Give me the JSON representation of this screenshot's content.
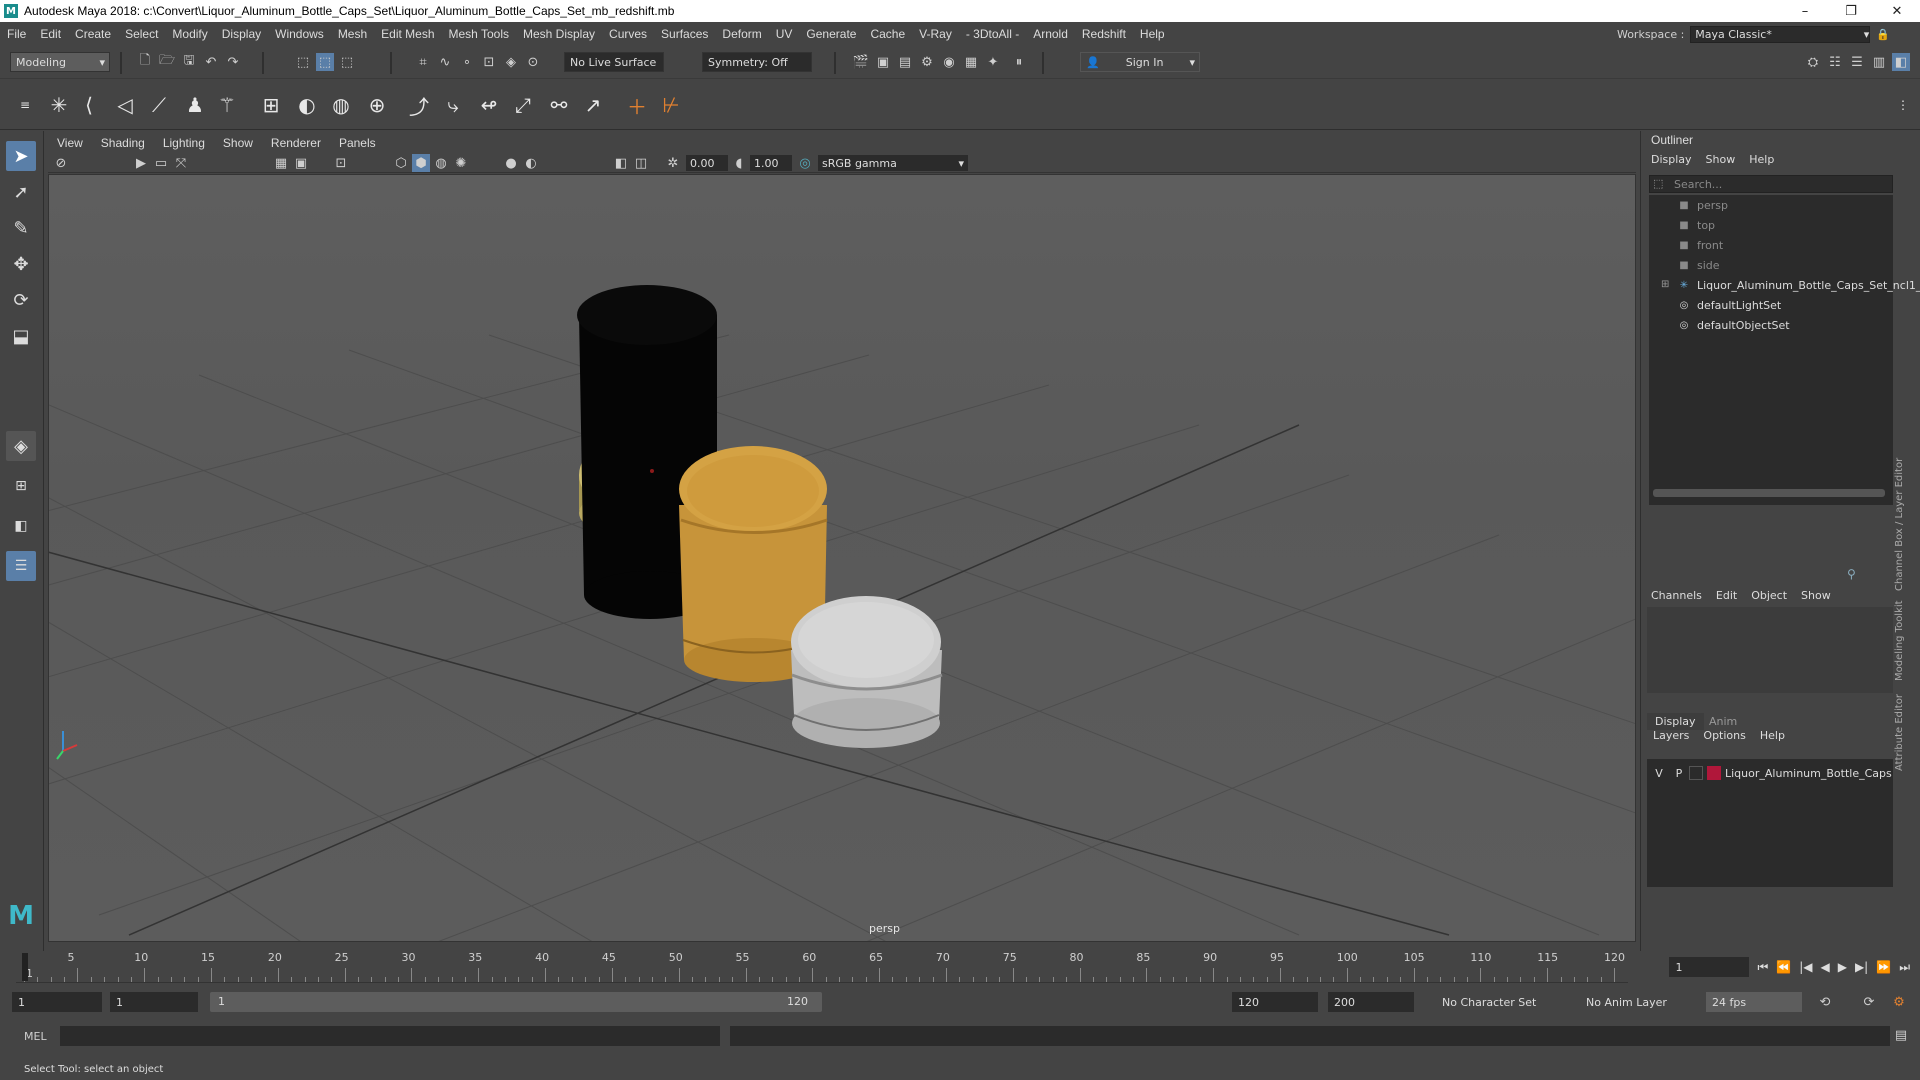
{
  "window": {
    "title": "Autodesk Maya 2018: c:\\Convert\\Liquor_Aluminum_Bottle_Caps_Set\\Liquor_Aluminum_Bottle_Caps_Set_mb_redshift.mb",
    "app_icon": "M",
    "minimize": "–",
    "maximize": "❐",
    "close": "✕"
  },
  "menubar": {
    "items": [
      "File",
      "Edit",
      "Create",
      "Select",
      "Modify",
      "Display",
      "Windows",
      "Mesh",
      "Edit Mesh",
      "Mesh Tools",
      "Mesh Display",
      "Curves",
      "Surfaces",
      "Deform",
      "UV",
      "Generate",
      "Cache",
      "V-Ray",
      "- 3DtoAll -",
      "Arnold",
      "Redshift",
      "Help"
    ],
    "workspace_label": "Workspace :",
    "workspace_value": "Maya Classic*"
  },
  "statusline": {
    "mode": "Modeling",
    "live_surface": "No Live Surface",
    "symmetry": "Symmetry: Off",
    "sign_in": "Sign In"
  },
  "panel": {
    "menus": [
      "View",
      "Shading",
      "Lighting",
      "Show",
      "Renderer",
      "Panels"
    ],
    "exposure": "0.00",
    "gamma": "1.00",
    "color_space": "sRGB gamma",
    "camera_label": "persp"
  },
  "outliner": {
    "title": "Outliner",
    "menus": [
      "Display",
      "Show",
      "Help"
    ],
    "search_placeholder": "Search...",
    "items": [
      {
        "label": "persp",
        "icon": "camera-icon",
        "dim": true
      },
      {
        "label": "top",
        "icon": "camera-icon",
        "dim": true
      },
      {
        "label": "front",
        "icon": "camera-icon",
        "dim": true
      },
      {
        "label": "side",
        "icon": "camera-icon",
        "dim": true
      },
      {
        "label": "Liquor_Aluminum_Bottle_Caps_Set_ncl1_",
        "icon": "group-icon",
        "dim": false
      },
      {
        "label": "defaultLightSet",
        "icon": "set-icon",
        "dim": false
      },
      {
        "label": "defaultObjectSet",
        "icon": "set-icon",
        "dim": false
      }
    ]
  },
  "channelbox": {
    "menus": [
      "Channels",
      "Edit",
      "Object",
      "Show"
    ],
    "tabs": [
      "Display",
      "Anim"
    ],
    "layer_menus": [
      "Layers",
      "Options",
      "Help"
    ],
    "layer": {
      "v": "V",
      "p": "P",
      "name": "Liquor_Aluminum_Bottle_Caps",
      "color": "#b0173a"
    },
    "side_tabs": [
      "Channel Box / Layer Editor",
      "Modeling Toolkit",
      "Attribute Editor"
    ]
  },
  "timeline": {
    "ticks": [
      "1",
      "5",
      "10",
      "15",
      "20",
      "25",
      "30",
      "35",
      "40",
      "45",
      "50",
      "55",
      "60",
      "65",
      "70",
      "75",
      "80",
      "85",
      "90",
      "95",
      "100",
      "105",
      "110",
      "115",
      "120"
    ],
    "current_frame": "1",
    "range_start": "1",
    "range_start2": "1",
    "range_inner_start": "1",
    "range_inner_end": "120",
    "anim_end": "120",
    "anim_end2": "200",
    "character_set": "No Character Set",
    "anim_layer": "No Anim Layer",
    "fps": "24 fps"
  },
  "commandline": {
    "label": "MEL"
  },
  "helpline": {
    "text": "Select Tool: select an object"
  },
  "colors": {
    "bg": "#444444",
    "viewport": "#5b5b5b",
    "accent": "#5a7fa8",
    "cap_gold_light": "#c8b46a",
    "cap_orange": "#d4a040",
    "cap_black": "#050505",
    "cap_silver": "#c6c6c6"
  }
}
